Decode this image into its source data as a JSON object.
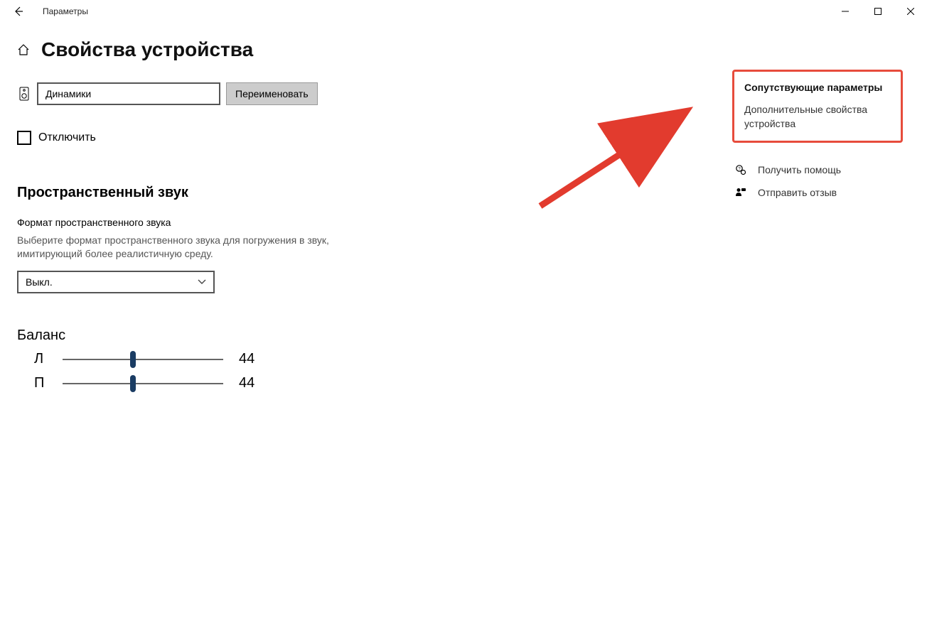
{
  "titlebar": {
    "app_title": "Параметры"
  },
  "page": {
    "title": "Свойства устройства",
    "device_name": "Динамики",
    "rename_label": "Переименовать",
    "disable_label": "Отключить"
  },
  "spatial": {
    "heading": "Пространственный звук",
    "format_label": "Формат пространственного звука",
    "description": "Выберите формат пространственного звука для погружения в звук, имитирующий более реалистичную среду.",
    "selected": "Выкл."
  },
  "balance": {
    "heading": "Баланс",
    "left_label": "Л",
    "left_value": "44",
    "right_label": "П",
    "right_value": "44"
  },
  "related": {
    "heading": "Сопутствующие параметры",
    "device_properties_link": "Дополнительные свойства устройства"
  },
  "help": {
    "get_help": "Получить помощь",
    "feedback": "Отправить отзыв"
  }
}
